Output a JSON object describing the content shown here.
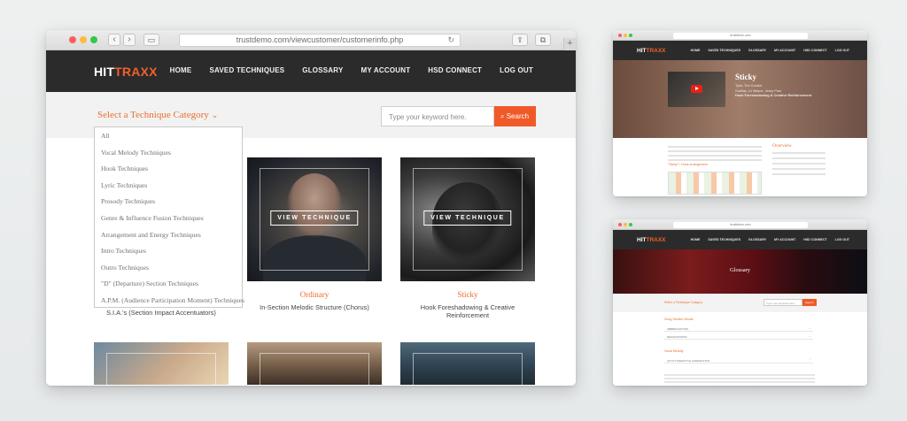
{
  "main_window": {
    "url": "trustdemo.com/viewcustomer/customerinfo.php",
    "logo": {
      "part1": "HIT",
      "part2": "TRAXX"
    },
    "nav": [
      "HOME",
      "SAVED TECHNIQUES",
      "GLOSSARY",
      "MY ACCOUNT",
      "HSD CONNECT",
      "LOG OUT"
    ],
    "category_label": "Select a Technique Category",
    "search_placeholder": "Type your keyword here.",
    "search_button": "Search",
    "dropdown_options": [
      "All",
      "Vocal Melody Techniques",
      "Hook Techniques",
      "Lyric Techniques",
      "Prosody Techniques",
      "Genre & Influence Fusion Techniques",
      "Arrangement and Energy Techniques",
      "Intro Techniques",
      "Outro Techniques",
      "\"D\" (Departure) Section Techniques",
      "A.P.M. (Audience Participation Moment) Techniques"
    ],
    "cards": [
      {
        "title": "",
        "subtitle": "S.I.A.'s (Section Impact Accentuators)",
        "button": "VIEW TECHNIQUE"
      },
      {
        "title": "Ordinary",
        "subtitle": "In-Section Melodic Structure (Chorus)",
        "button": "VIEW TECHNIQUE"
      },
      {
        "title": "Sticky",
        "subtitle": "Hook Foreshadowing & Creative Reinforcement",
        "button": "VIEW TECHNIQUE"
      }
    ]
  },
  "mini_window_1": {
    "url": "trustdemo.com",
    "logo": {
      "part1": "HIT",
      "part2": "TRAXX"
    },
    "nav": [
      "HOME",
      "SAVED TECHNIQUES",
      "GLOSSARY",
      "MY ACCOUNT",
      "HSD CONNECT",
      "LOG OUT"
    ],
    "title": "Sticky",
    "artist": "Tyler, The Creator",
    "credits": "Gorillaz, Lil Wayne, Jessy Paul",
    "technique": "Hook Foreshadowing & Creative Reinforcement",
    "overview_label": "Overview",
    "table_label": "\"Sticky\" / Hook arrangement"
  },
  "mini_window_2": {
    "url": "trustdemo.com",
    "logo": {
      "part1": "HIT",
      "part2": "TRAXX"
    },
    "nav": [
      "HOME",
      "SAVED TECHNIQUES",
      "GLOSSARY",
      "MY ACCOUNT",
      "HSD CONNECT",
      "LOG OUT"
    ],
    "hero_title": "Glossary",
    "category_label": "Select a Technique Category",
    "search_placeholder": "Type your keyword here.",
    "search_button": "Search",
    "section1": "Song Section Words",
    "rows1": [
      "ABBREVIATIONS",
      "DESIGNATIONS"
    ],
    "section2": "Vocal Melody",
    "rows2": [
      "AUTO TUNE/PITCH CORRECTION"
    ]
  }
}
